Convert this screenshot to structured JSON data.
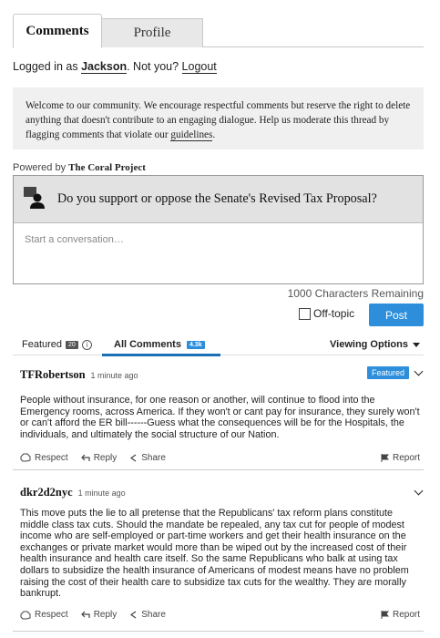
{
  "tabs": {
    "comments": "Comments",
    "profile": "Profile"
  },
  "login": {
    "prefix": "Logged in as ",
    "username": "Jackson",
    "middle": ". Not you? ",
    "logout": "Logout"
  },
  "welcome": {
    "text": "Welcome to our community. We encourage respectful comments but reserve the right to delete anything that doesn't contribute to an engaging dialogue. Help us moderate this thread by flagging comments that violate our ",
    "link": "guidelines",
    "suffix": "."
  },
  "powered": {
    "prefix": "Powered by ",
    "brand": "The Coral Project"
  },
  "question": {
    "text": "Do you support or oppose the Senate's Revised Tax Proposal?",
    "icon": "user-question-icon"
  },
  "composer": {
    "placeholder": "Start a conversation…",
    "chars_remaining": "1000 Characters Remaining",
    "offtopic": "Off-topic",
    "post": "Post"
  },
  "sort": {
    "featured": "Featured",
    "featured_count": "20",
    "all": "All Comments",
    "all_count": "4.3k",
    "viewing": "Viewing Options"
  },
  "comments": [
    {
      "author": "TFRobertson",
      "time": "1 minute ago",
      "featured": "Featured",
      "body": "People without insurance, for one reason or another, will continue to flood into the Emergency rooms, across America. If they won't or cant pay for insurance, they surely won't or can't afford the ER bill------Guess what the consequences will be for the Hospitals, the individuals, and ultimately the social structure of our Nation.",
      "respect": "Respect",
      "reply": "Reply",
      "share": "Share",
      "report": "Report"
    },
    {
      "author": "dkr2d2nyc",
      "time": "1 minute ago",
      "body": "This move puts the lie to all pretense that the Republicans' tax reform plans constitute middle class tax cuts. Should the mandate be repealed, any tax cut for people of modest income who are self-employed or part-time workers and get their health insurance on the exchanges or private market would more than be wiped out by the increased cost of their health insurance and health care itself. So the same Republicans who balk at using tax dollars to subsidize the health insurance of Americans of modest means have no problem raising the cost of their health care to subsidize tax cuts for the wealthy. They are morally bankrupt.",
      "respect": "Respect",
      "reply": "Reply",
      "share": "Share",
      "report": "Report"
    }
  ],
  "colors": {
    "accent": "#2d8fdb",
    "tab_underline": "#1a6fb5",
    "panel_bg": "#f0f0f0",
    "question_bg": "#e2e2e2"
  }
}
